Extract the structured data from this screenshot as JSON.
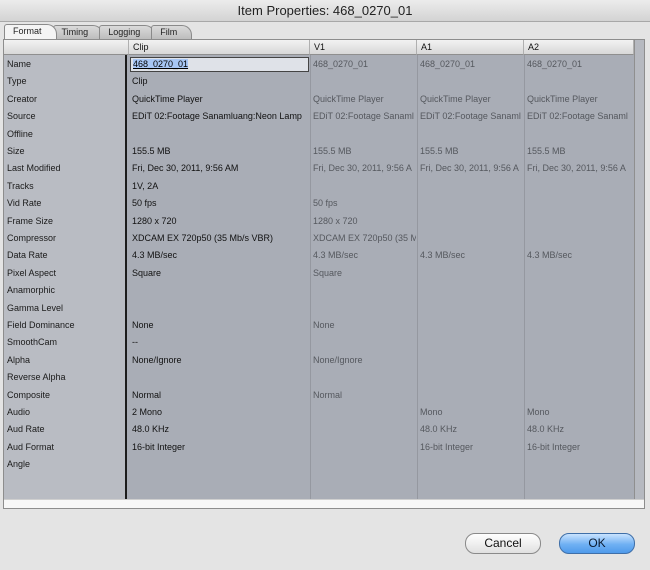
{
  "window": {
    "title": "Item Properties: 468_0270_01"
  },
  "tabs": [
    {
      "label": "Format",
      "active": true
    },
    {
      "label": "Timing",
      "active": false
    },
    {
      "label": "Logging",
      "active": false
    },
    {
      "label": "Film",
      "active": false
    }
  ],
  "columns": {
    "clip": "Clip",
    "v1": "V1",
    "a1": "A1",
    "a2": "A2"
  },
  "rows": [
    {
      "label": "Name",
      "clip": "468_0270_01",
      "v1": "468_0270_01",
      "a1": "468_0270_01",
      "a2": "468_0270_01"
    },
    {
      "label": "Type",
      "clip": "Clip",
      "v1": "",
      "a1": "",
      "a2": ""
    },
    {
      "label": "Creator",
      "clip": "QuickTime Player",
      "v1": "QuickTime Player",
      "a1": "QuickTime Player",
      "a2": "QuickTime Player"
    },
    {
      "label": "Source",
      "clip": "EDiT 02:Footage Sanamluang:Neon Lamp",
      "v1": "EDiT 02:Footage Sanaml",
      "a1": "EDiT 02:Footage Sanaml",
      "a2": "EDiT 02:Footage Sanaml"
    },
    {
      "label": "Offline",
      "clip": "",
      "v1": "",
      "a1": "",
      "a2": ""
    },
    {
      "label": "Size",
      "clip": "155.5 MB",
      "v1": "155.5 MB",
      "a1": "155.5 MB",
      "a2": "155.5 MB"
    },
    {
      "label": "Last Modified",
      "clip": "Fri, Dec 30, 2011, 9:56 AM",
      "v1": "Fri, Dec 30, 2011, 9:56 A",
      "a1": "Fri, Dec 30, 2011, 9:56 A",
      "a2": "Fri, Dec 30, 2011, 9:56 A"
    },
    {
      "label": "Tracks",
      "clip": "1V, 2A",
      "v1": "",
      "a1": "",
      "a2": ""
    },
    {
      "label": "Vid Rate",
      "clip": "50 fps",
      "v1": "50 fps",
      "a1": "",
      "a2": ""
    },
    {
      "label": "Frame Size",
      "clip": "1280 x 720",
      "v1": "1280 x 720",
      "a1": "",
      "a2": ""
    },
    {
      "label": "Compressor",
      "clip": "XDCAM EX 720p50 (35 Mb/s VBR)",
      "v1": "XDCAM EX 720p50 (35 M",
      "a1": "",
      "a2": ""
    },
    {
      "label": "Data Rate",
      "clip": "4.3 MB/sec",
      "v1": "4.3 MB/sec",
      "a1": "4.3 MB/sec",
      "a2": "4.3 MB/sec"
    },
    {
      "label": "Pixel Aspect",
      "clip": "Square",
      "v1": "Square",
      "a1": "",
      "a2": ""
    },
    {
      "label": "Anamorphic",
      "clip": "",
      "v1": "",
      "a1": "",
      "a2": ""
    },
    {
      "label": "Gamma Level",
      "clip": "",
      "v1": "",
      "a1": "",
      "a2": ""
    },
    {
      "label": "Field Dominance",
      "clip": "None",
      "v1": "None",
      "a1": "",
      "a2": ""
    },
    {
      "label": "SmoothCam",
      "clip": "--",
      "v1": "",
      "a1": "",
      "a2": ""
    },
    {
      "label": "Alpha",
      "clip": "None/Ignore",
      "v1": "None/Ignore",
      "a1": "",
      "a2": ""
    },
    {
      "label": "Reverse Alpha",
      "clip": "",
      "v1": "",
      "a1": "",
      "a2": ""
    },
    {
      "label": "Composite",
      "clip": "Normal",
      "v1": "Normal",
      "a1": "",
      "a2": ""
    },
    {
      "label": "Audio",
      "clip": "2 Mono",
      "v1": "",
      "a1": "Mono",
      "a2": "Mono"
    },
    {
      "label": "Aud Rate",
      "clip": "48.0 KHz",
      "v1": "",
      "a1": "48.0 KHz",
      "a2": "48.0 KHz"
    },
    {
      "label": "Aud Format",
      "clip": "16-bit Integer",
      "v1": "",
      "a1": "16-bit Integer",
      "a2": "16-bit Integer"
    },
    {
      "label": "Angle",
      "clip": "",
      "v1": "",
      "a1": "",
      "a2": ""
    }
  ],
  "buttons": {
    "cancel": "Cancel",
    "ok": "OK"
  }
}
